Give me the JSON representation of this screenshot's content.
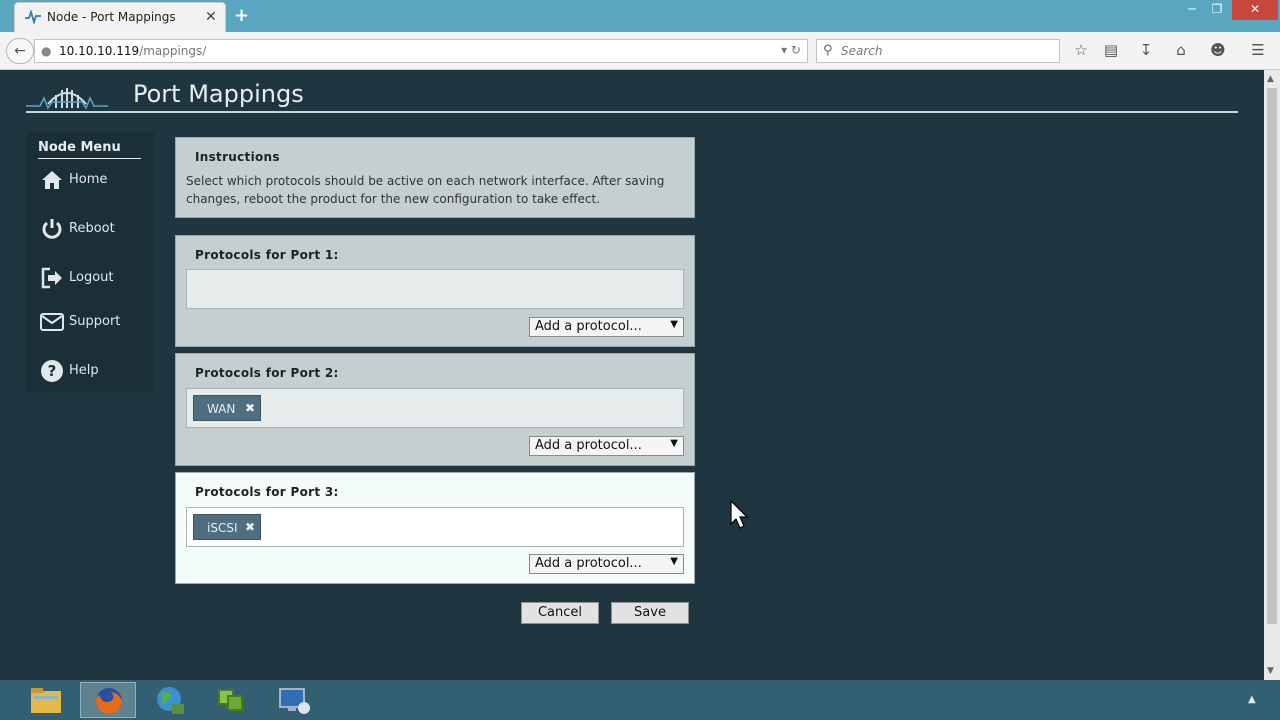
{
  "browser": {
    "tab_title": "Node - Port Mappings",
    "tab_close": "✕",
    "new_tab": "+",
    "url_host": "10.10.10.119",
    "url_path": "/mappings/",
    "search_placeholder": "Search"
  },
  "header": {
    "title": "Port Mappings"
  },
  "sidebar": {
    "title": "Node Menu",
    "items": [
      {
        "label": "Home",
        "icon": "home-icon"
      },
      {
        "label": "Reboot",
        "icon": "power-icon"
      },
      {
        "label": "Logout",
        "icon": "logout-icon"
      },
      {
        "label": "Support",
        "icon": "envelope-icon"
      },
      {
        "label": "Help",
        "icon": "help-icon"
      }
    ]
  },
  "instructions": {
    "heading": "Instructions",
    "text": "Select which protocols should be active on each network interface. After saving changes, reboot the product for the new configuration to take effect."
  },
  "ports": [
    {
      "heading": "Protocols for Port 1:",
      "protocols": [],
      "select_label": "Add a protocol..."
    },
    {
      "heading": "Protocols for Port 2:",
      "protocols": [
        "WAN"
      ],
      "select_label": "Add a protocol..."
    },
    {
      "heading": "Protocols for Port 3:",
      "protocols": [
        "iSCSI"
      ],
      "select_label": "Add a protocol..."
    }
  ],
  "chip_remove": "✖",
  "actions": {
    "cancel": "Cancel",
    "save": "Save"
  },
  "colors": {
    "page_bg": "#1f3640",
    "panel_bg": "#c5cfcf",
    "active_panel_bg": "#f4fbfb",
    "chip_bg": "#4f6f80",
    "chrome_accent": "#5aa5c0"
  }
}
